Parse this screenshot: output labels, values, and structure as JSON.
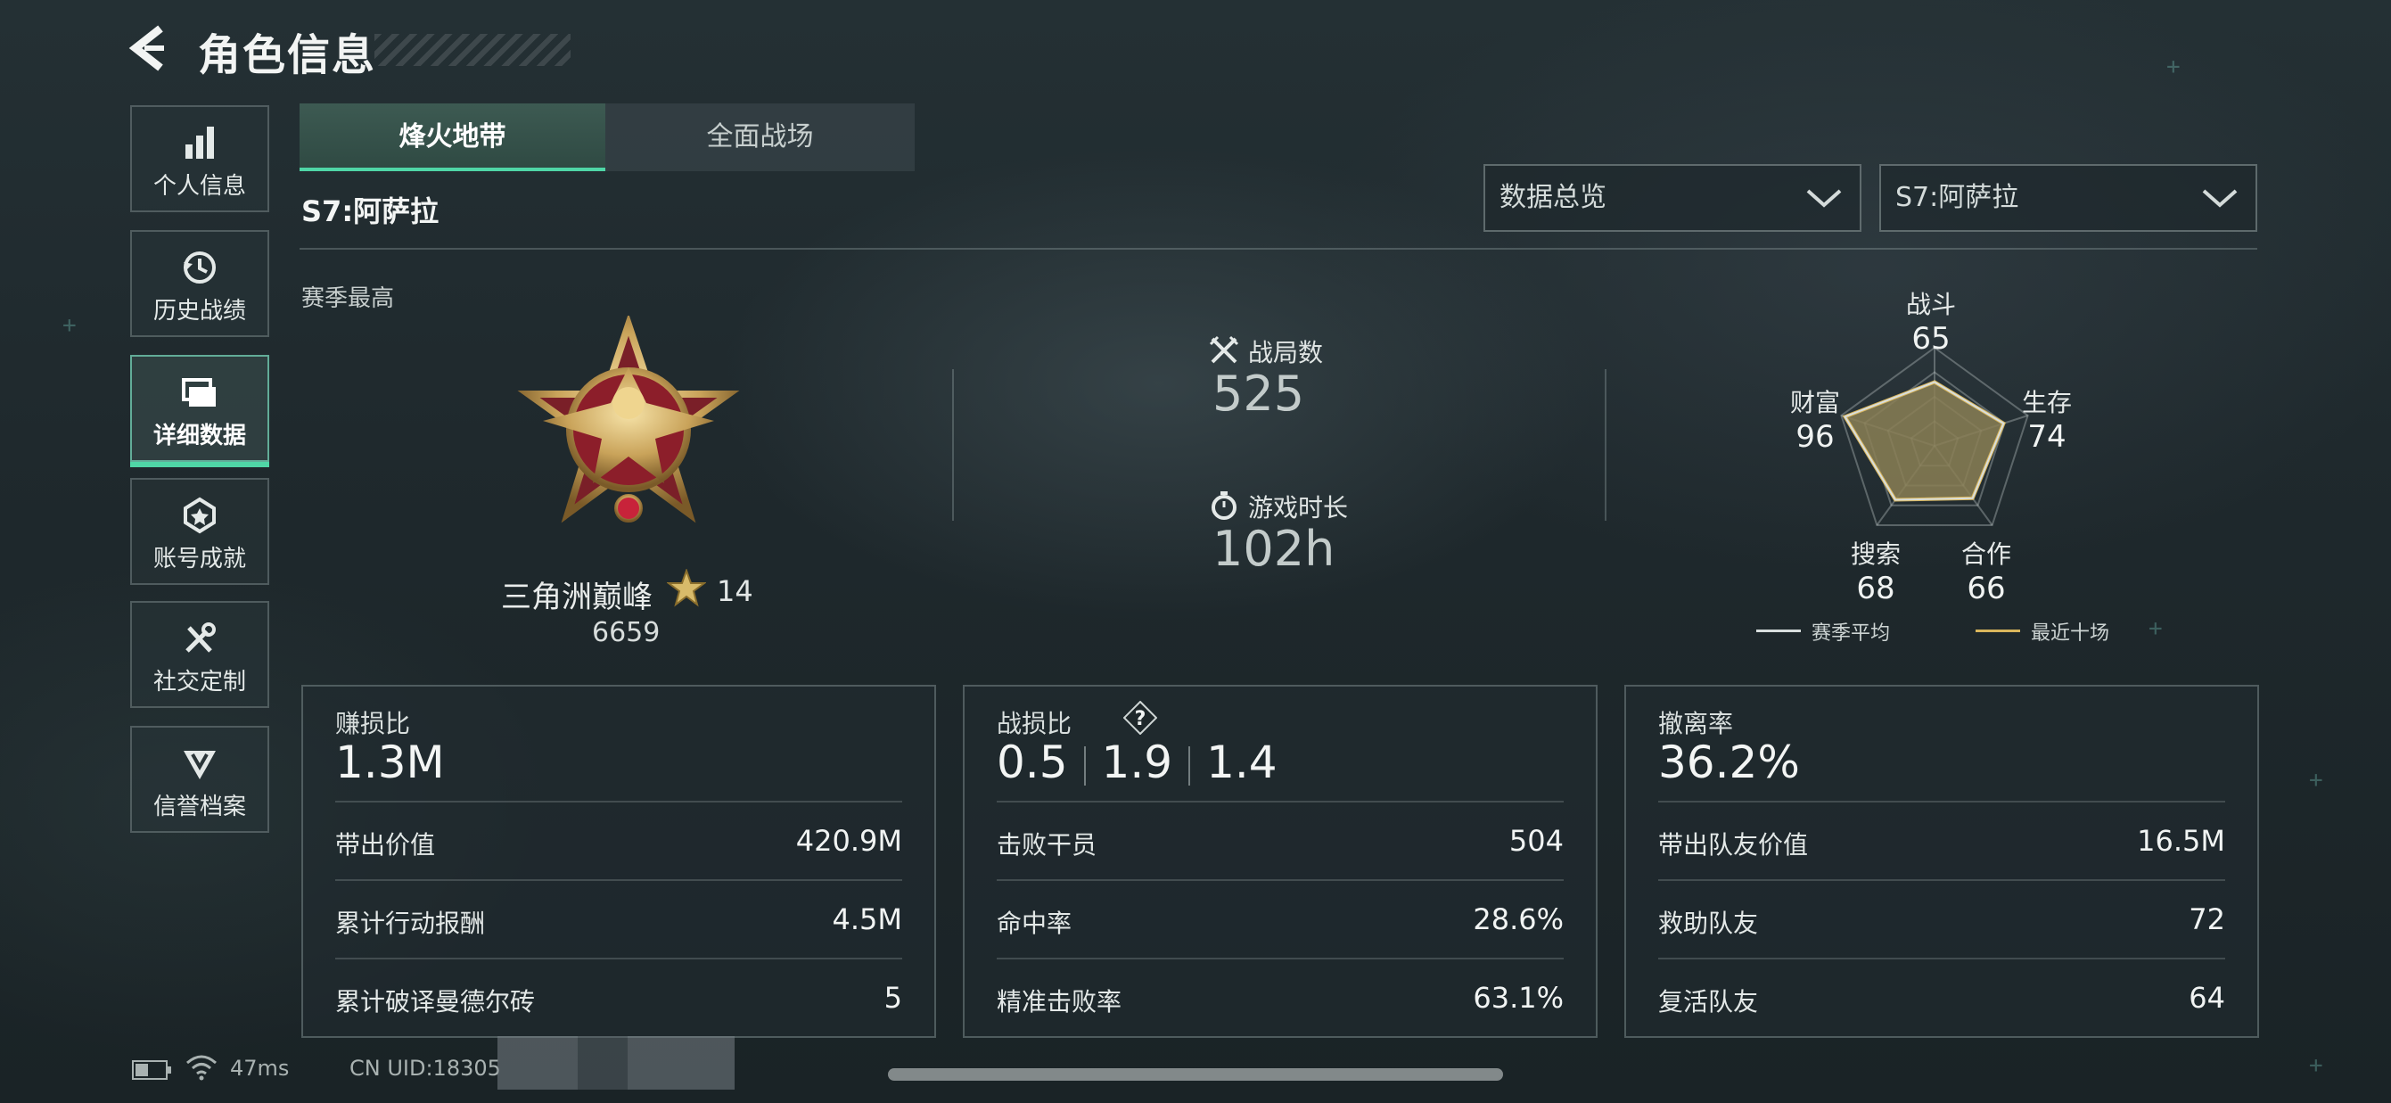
{
  "header": {
    "title": "角色信息"
  },
  "sidebar": {
    "items": [
      {
        "label": "个人信息",
        "icon": "bar-chart-icon"
      },
      {
        "label": "历史战绩",
        "icon": "history-clock-icon"
      },
      {
        "label": "详细数据",
        "icon": "folder-icon",
        "active": true
      },
      {
        "label": "账号成就",
        "icon": "achievement-badge-icon"
      },
      {
        "label": "社交定制",
        "icon": "tools-icon"
      },
      {
        "label": "信誉档案",
        "icon": "reputation-shield-icon"
      }
    ]
  },
  "tabs": [
    {
      "label": "烽火地带",
      "active": true
    },
    {
      "label": "全面战场",
      "active": false
    }
  ],
  "season_title": "S7:阿萨拉",
  "filters": {
    "view": "数据总览",
    "season": "S7:阿萨拉"
  },
  "section_label": "赛季最高",
  "rank": {
    "name": "三角洲巅峰",
    "stars": "14",
    "score": "6659"
  },
  "overview": {
    "matches_label": "战局数",
    "matches_value": "525",
    "playtime_label": "游戏时长",
    "playtime_value": "102h"
  },
  "radar": {
    "axes": [
      {
        "label": "战斗",
        "value": "65",
        "avg": 0.65,
        "recent": 0.65
      },
      {
        "label": "生存",
        "value": "74",
        "avg": 0.74,
        "recent": 0.74
      },
      {
        "label": "合作",
        "value": "66",
        "avg": 0.66,
        "recent": 0.66
      },
      {
        "label": "搜索",
        "value": "68",
        "avg": 0.68,
        "recent": 0.68
      },
      {
        "label": "财富",
        "value": "96",
        "avg": 0.96,
        "recent": 0.96
      }
    ],
    "legend": {
      "season_avg": "赛季平均",
      "recent_ten": "最近十场"
    },
    "colors": {
      "season_avg": "#d8dedd",
      "recent_ten": "#d9b65c",
      "fill": "#8a7f55"
    }
  },
  "cards": {
    "profit": {
      "title": "赚损比",
      "main": "1.3M",
      "rows": [
        {
          "label": "带出价值",
          "value": "420.9M"
        },
        {
          "label": "累计行动报酬",
          "value": "4.5M"
        },
        {
          "label": "累计破译曼德尔砖",
          "value": "5"
        }
      ]
    },
    "kd": {
      "title": "战损比",
      "help": "?",
      "values": [
        "0.5",
        "1.9",
        "1.4"
      ],
      "rows": [
        {
          "label": "击败干员",
          "value": "504"
        },
        {
          "label": "命中率",
          "value": "28.6%"
        },
        {
          "label": "精准击败率",
          "value": "63.1%"
        }
      ]
    },
    "extract": {
      "title": "撤离率",
      "main": "36.2%",
      "rows": [
        {
          "label": "带出队友价值",
          "value": "16.5M"
        },
        {
          "label": "救助队友",
          "value": "72"
        },
        {
          "label": "复活队友",
          "value": "64"
        }
      ]
    }
  },
  "footer": {
    "ping": "47ms",
    "uid": "CN UID:18305"
  },
  "colors": {
    "accent": "#4fd6a6",
    "background": "#1f292d"
  }
}
